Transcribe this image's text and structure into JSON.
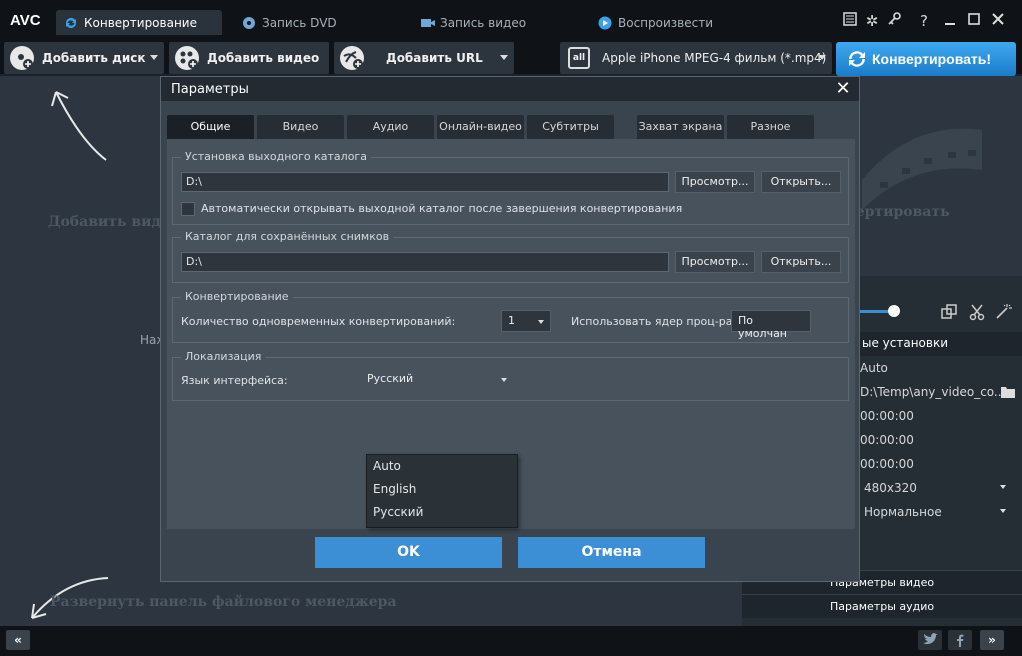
{
  "app": {
    "logo": "AVC"
  },
  "tabs": [
    {
      "label": "Конвертирование",
      "active": true
    },
    {
      "label": "Запись DVD",
      "active": false
    },
    {
      "label": "Запись видео",
      "active": false
    },
    {
      "label": "Воспроизвести",
      "active": false
    }
  ],
  "window": {
    "help": "?"
  },
  "toolbar": {
    "add_disc": "Добавить диск",
    "add_video": "Добавить видео",
    "add_url": "Добавить URL",
    "profile_badge": "all",
    "profile": "Apple iPhone MPEG-4 фильм (*.mp4)",
    "convert": "Конвертировать!"
  },
  "background": {
    "add_video_hint": "Добавить виде",
    "convert_hint": "вертировать",
    "press_hint": "Наж",
    "expand_panel": "Развернуть панель файлового менеджера"
  },
  "right_panel": {
    "basic_settings": "ые установки",
    "rows": [
      "Auto",
      "D:\\Temp\\any_video_co...",
      "00:00:00",
      "00:00:00",
      "00:00:00",
      "480x320",
      "Нормальное"
    ],
    "video_params": "Параметры видео",
    "audio_params": "Параметры аудио"
  },
  "dialog": {
    "title": "Параметры",
    "tabs": [
      "Общие",
      "Видео",
      "Аудио",
      "Онлайн-видео",
      "Субтитры",
      "Захват экрана",
      "Разное"
    ],
    "active_tab": 0,
    "output": {
      "title": "Установка выходного каталога",
      "path": "D:\\",
      "browse": "Просмотр...",
      "open": "Открыть...",
      "auto_open_label": "Автоматически открывать выходной каталог после завершения конвертирования",
      "auto_open_checked": false
    },
    "snapshots": {
      "title": "Каталог для сохранённых снимков",
      "path": "D:\\",
      "browse": "Просмотр...",
      "open": "Открыть..."
    },
    "conversion": {
      "title": "Конвертирование",
      "simultaneous_label": "Количество одновременных конвертирований:",
      "simultaneous_value": "1",
      "cores_label": "Использовать ядер проц-ра",
      "cores_value": "По умолчан"
    },
    "localization": {
      "title": "Локализация",
      "language_label": "Язык интерфейса:",
      "language_value": "Русский",
      "options": [
        "Auto",
        "English",
        "Русский"
      ]
    },
    "ok": "OK",
    "cancel": "Отмена"
  }
}
